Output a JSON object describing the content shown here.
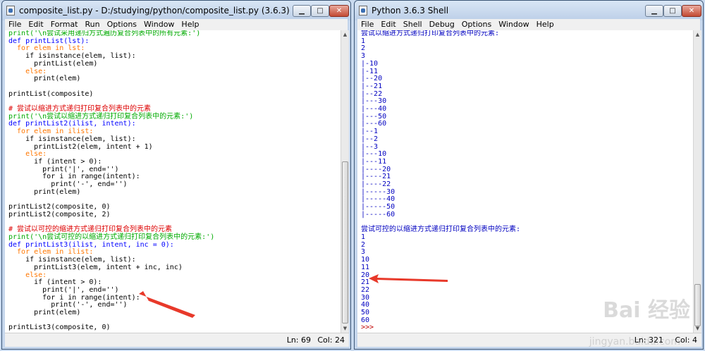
{
  "editor": {
    "title": "composite_list.py - D:/studying/python/composite_list.py (3.6.3)",
    "menu": [
      "File",
      "Edit",
      "Format",
      "Run",
      "Options",
      "Window",
      "Help"
    ],
    "status": {
      "ln": "Ln: 69",
      "col": "Col: 24"
    }
  },
  "shell": {
    "title": "Python 3.6.3 Shell",
    "menu": [
      "File",
      "Edit",
      "Shell",
      "Debug",
      "Options",
      "Window",
      "Help"
    ],
    "status": {
      "ln": "Ln: 321",
      "col": "Col: 4"
    },
    "output_header_1": "尝试以缩进方式递归打印复合列表中的元素:",
    "output_lines_1": [
      "1",
      "2",
      "3",
      "|-10",
      "|-11",
      "|--20",
      "|--21",
      "|--22",
      "|---30",
      "|---40",
      "|---50",
      "|---60",
      "|--1",
      "|--2",
      "|--3",
      "|---10",
      "|---11",
      "|----20",
      "|----21",
      "|----22",
      "|-----30",
      "|-----40",
      "|-----50",
      "|-----60"
    ],
    "output_header_2": "尝试可控的以缩进方式递归打印复合列表中的元素:",
    "output_lines_2": [
      "1",
      "2",
      "3",
      "10",
      "11",
      "20",
      "21",
      "22",
      "30",
      "40",
      "50",
      "60"
    ],
    "prompt": ">>>"
  },
  "code": {
    "l01": "print('\\n尝试采用递归方式遍历复合列表中的所有元素:')",
    "l02": "def printList(lst):",
    "l03": "  for elem in lst:",
    "l04": "    if isinstance(elem, list):",
    "l05": "      printList(elem)",
    "l06": "    else:",
    "l07": "      print(elem)",
    "l08": "printList(composite)",
    "l09": "# 尝试以缩进方式递归打印复合列表中的元素",
    "l10": "print('\\n尝试以缩进方式递归打印复合列表中的元素:')",
    "l11": "def printList2(ilist, intent):",
    "l12": "  for elem in ilist:",
    "l13": "    if isinstance(elem, list):",
    "l14": "      printList2(elem, intent + 1)",
    "l15": "    else:",
    "l16": "      if (intent > 0):",
    "l17": "        print('|', end='')",
    "l18": "        for i in range(intent):",
    "l19": "          print('-', end='')",
    "l20": "      print(elem)",
    "l21": "printList2(composite, 0)",
    "l22": "printList2(composite, 2)",
    "l23": "# 尝试以可控的缩进方式递归打印复合列表中的元素",
    "l24": "print('\\n尝试可控的以缩进方式递归打印复合列表中的元素:')",
    "l25": "def printList3(ilist, intent, inc = 0):",
    "l26": "  for elem in ilist:",
    "l27": "    if isinstance(elem, list):",
    "l28": "      printList3(elem, intent + inc, inc)",
    "l29": "    else:",
    "l30": "      if (intent > 0):",
    "l31": "        print('|', end='')",
    "l32": "        for i in range(intent):",
    "l33": "          print('-', end='')",
    "l34": "      print(elem)",
    "l35": "printList3(composite, 0)"
  },
  "watermark": {
    "logo": "Bai 经验",
    "url": "jingyan.baidu.com"
  },
  "colors": {
    "keyword": "#ff7700",
    "builtin": "#900090",
    "string": "#00aa00",
    "comment": "#dd0000",
    "definition": "#0000ff",
    "output": "#0000c0",
    "arrow": "#e8392a"
  }
}
